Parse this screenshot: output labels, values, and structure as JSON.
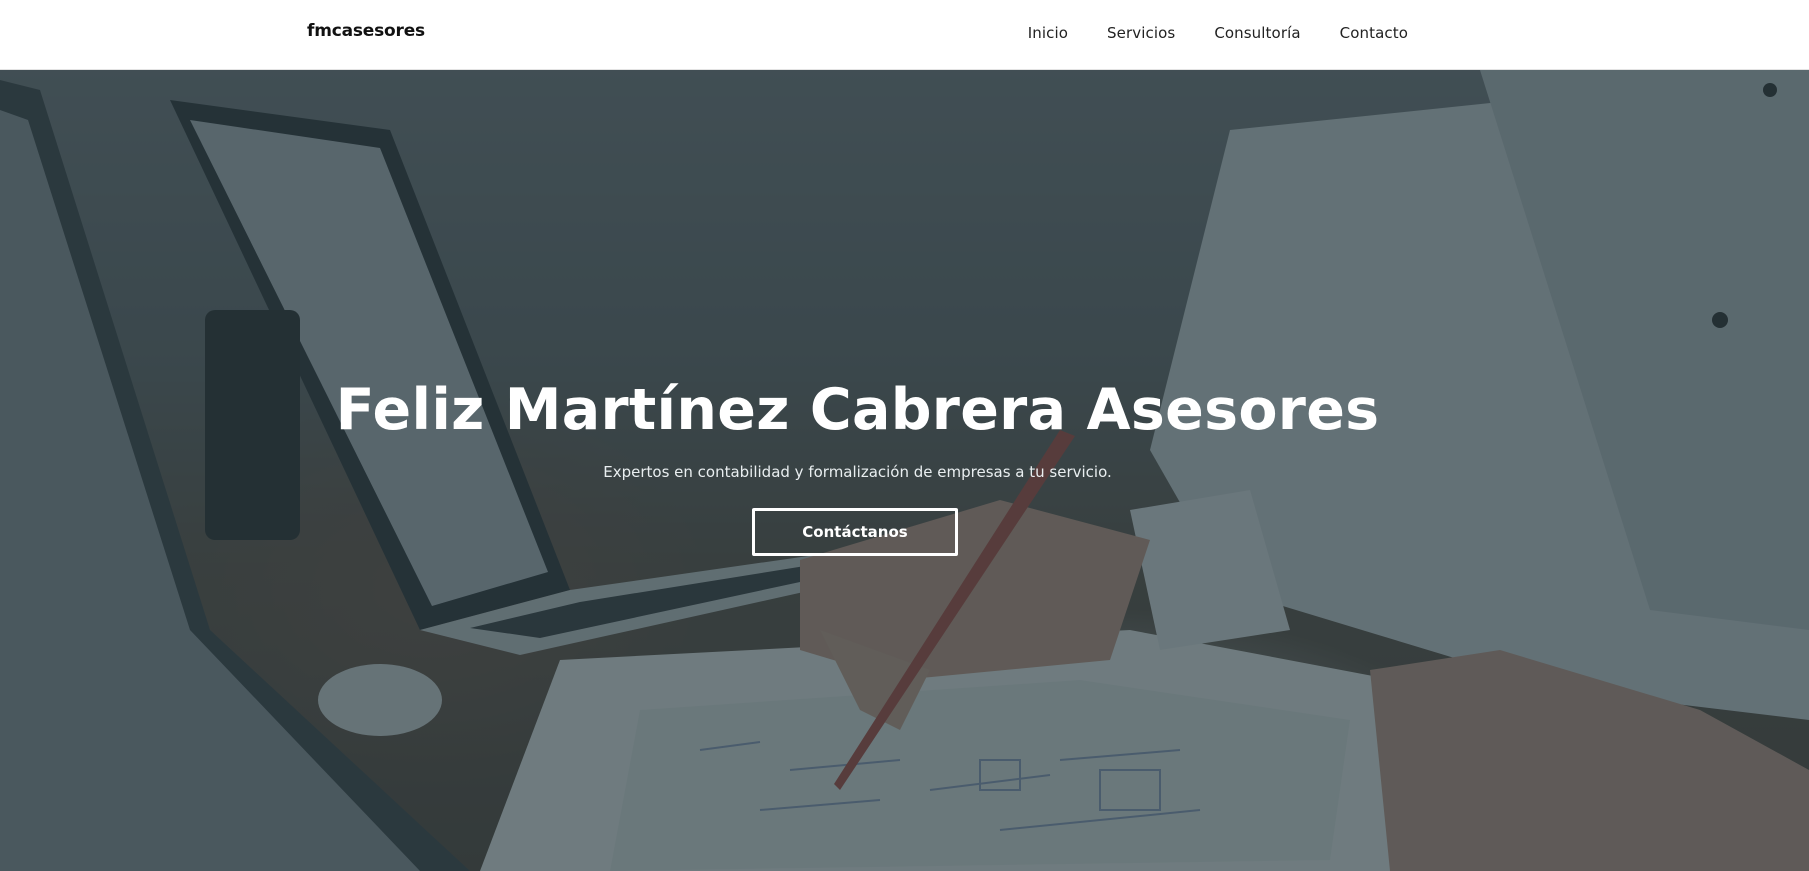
{
  "header": {
    "brand": "fmcasesores",
    "nav": [
      {
        "label": "Inicio"
      },
      {
        "label": "Servicios"
      },
      {
        "label": "Consultoría"
      },
      {
        "label": "Contacto"
      }
    ]
  },
  "hero": {
    "title": "Feliz Martínez Cabrera Asesores",
    "subtitle": "Expertos en contabilidad y formalización de empresas a tu servicio.",
    "cta_label": "Contáctanos",
    "background_image": "office-meeting-photo",
    "overlay_color": "#21343a"
  },
  "colors": {
    "header_bg": "#ffffff",
    "text_dark": "#111111",
    "text_light": "#ffffff"
  }
}
